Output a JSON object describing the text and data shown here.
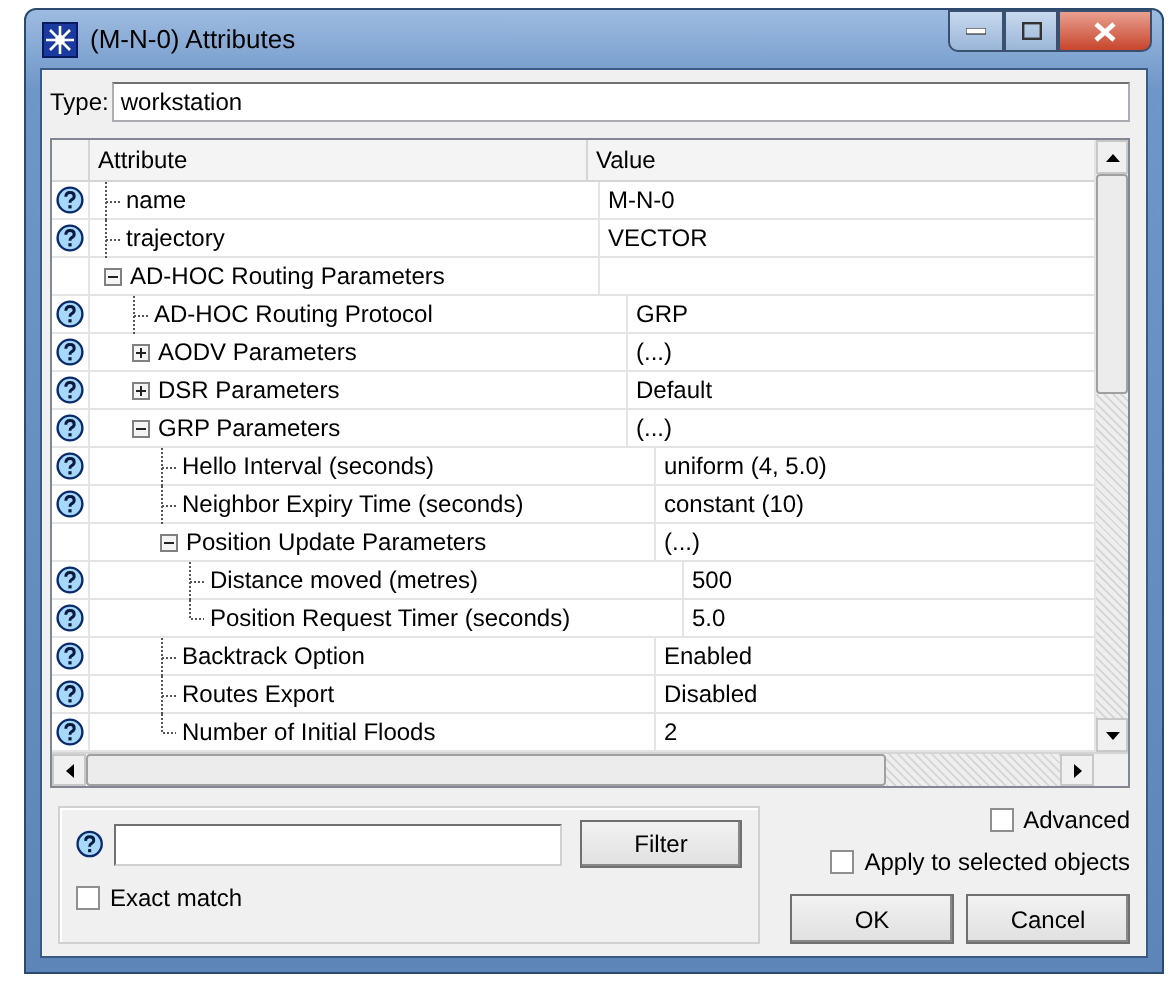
{
  "window": {
    "title": "(M-N-0) Attributes"
  },
  "type_field": {
    "label": "Type:",
    "value": "workstation"
  },
  "table": {
    "columns": [
      "Attribute",
      "Value"
    ],
    "rows": [
      {
        "name": "name",
        "value": "M-N-0",
        "help": true
      },
      {
        "name": "trajectory",
        "value": "VECTOR",
        "help": true
      },
      {
        "name": "AD-HOC Routing Parameters",
        "help": false,
        "expanded": true,
        "children": [
          {
            "name": "AD-HOC Routing Protocol",
            "value": "GRP",
            "help": true
          },
          {
            "name": "AODV Parameters",
            "value": "(...)",
            "help": true,
            "expanded": false
          },
          {
            "name": "DSR Parameters",
            "value": "Default",
            "help": true,
            "expanded": false
          },
          {
            "name": "GRP Parameters",
            "value": "(...)",
            "help": true,
            "expanded": true,
            "children": [
              {
                "name": "Hello Interval (seconds)",
                "value": "uniform (4, 5.0)",
                "help": true
              },
              {
                "name": "Neighbor Expiry Time (seconds)",
                "value": "constant (10)",
                "help": true
              },
              {
                "name": "Position Update Parameters",
                "value": "(...)",
                "help": false,
                "expanded": true,
                "children": [
                  {
                    "name": "Distance moved (metres)",
                    "value": "500",
                    "help": true
                  },
                  {
                    "name": "Position Request Timer (seconds)",
                    "value": "5.0",
                    "help": true
                  }
                ]
              },
              {
                "name": "Backtrack Option",
                "value": "Enabled",
                "help": true
              },
              {
                "name": "Routes Export",
                "value": "Disabled",
                "help": true
              },
              {
                "name": "Number of Initial Floods",
                "value": "2",
                "help": true
              }
            ]
          }
        ]
      }
    ]
  },
  "filter": {
    "button": "Filter",
    "exact_match": {
      "label": "Exact match",
      "checked": false
    }
  },
  "options": [
    {
      "label": "Advanced",
      "checked": false
    },
    {
      "label": "Apply to selected objects",
      "checked": false
    }
  ],
  "buttons": [
    "OK",
    "Cancel"
  ]
}
